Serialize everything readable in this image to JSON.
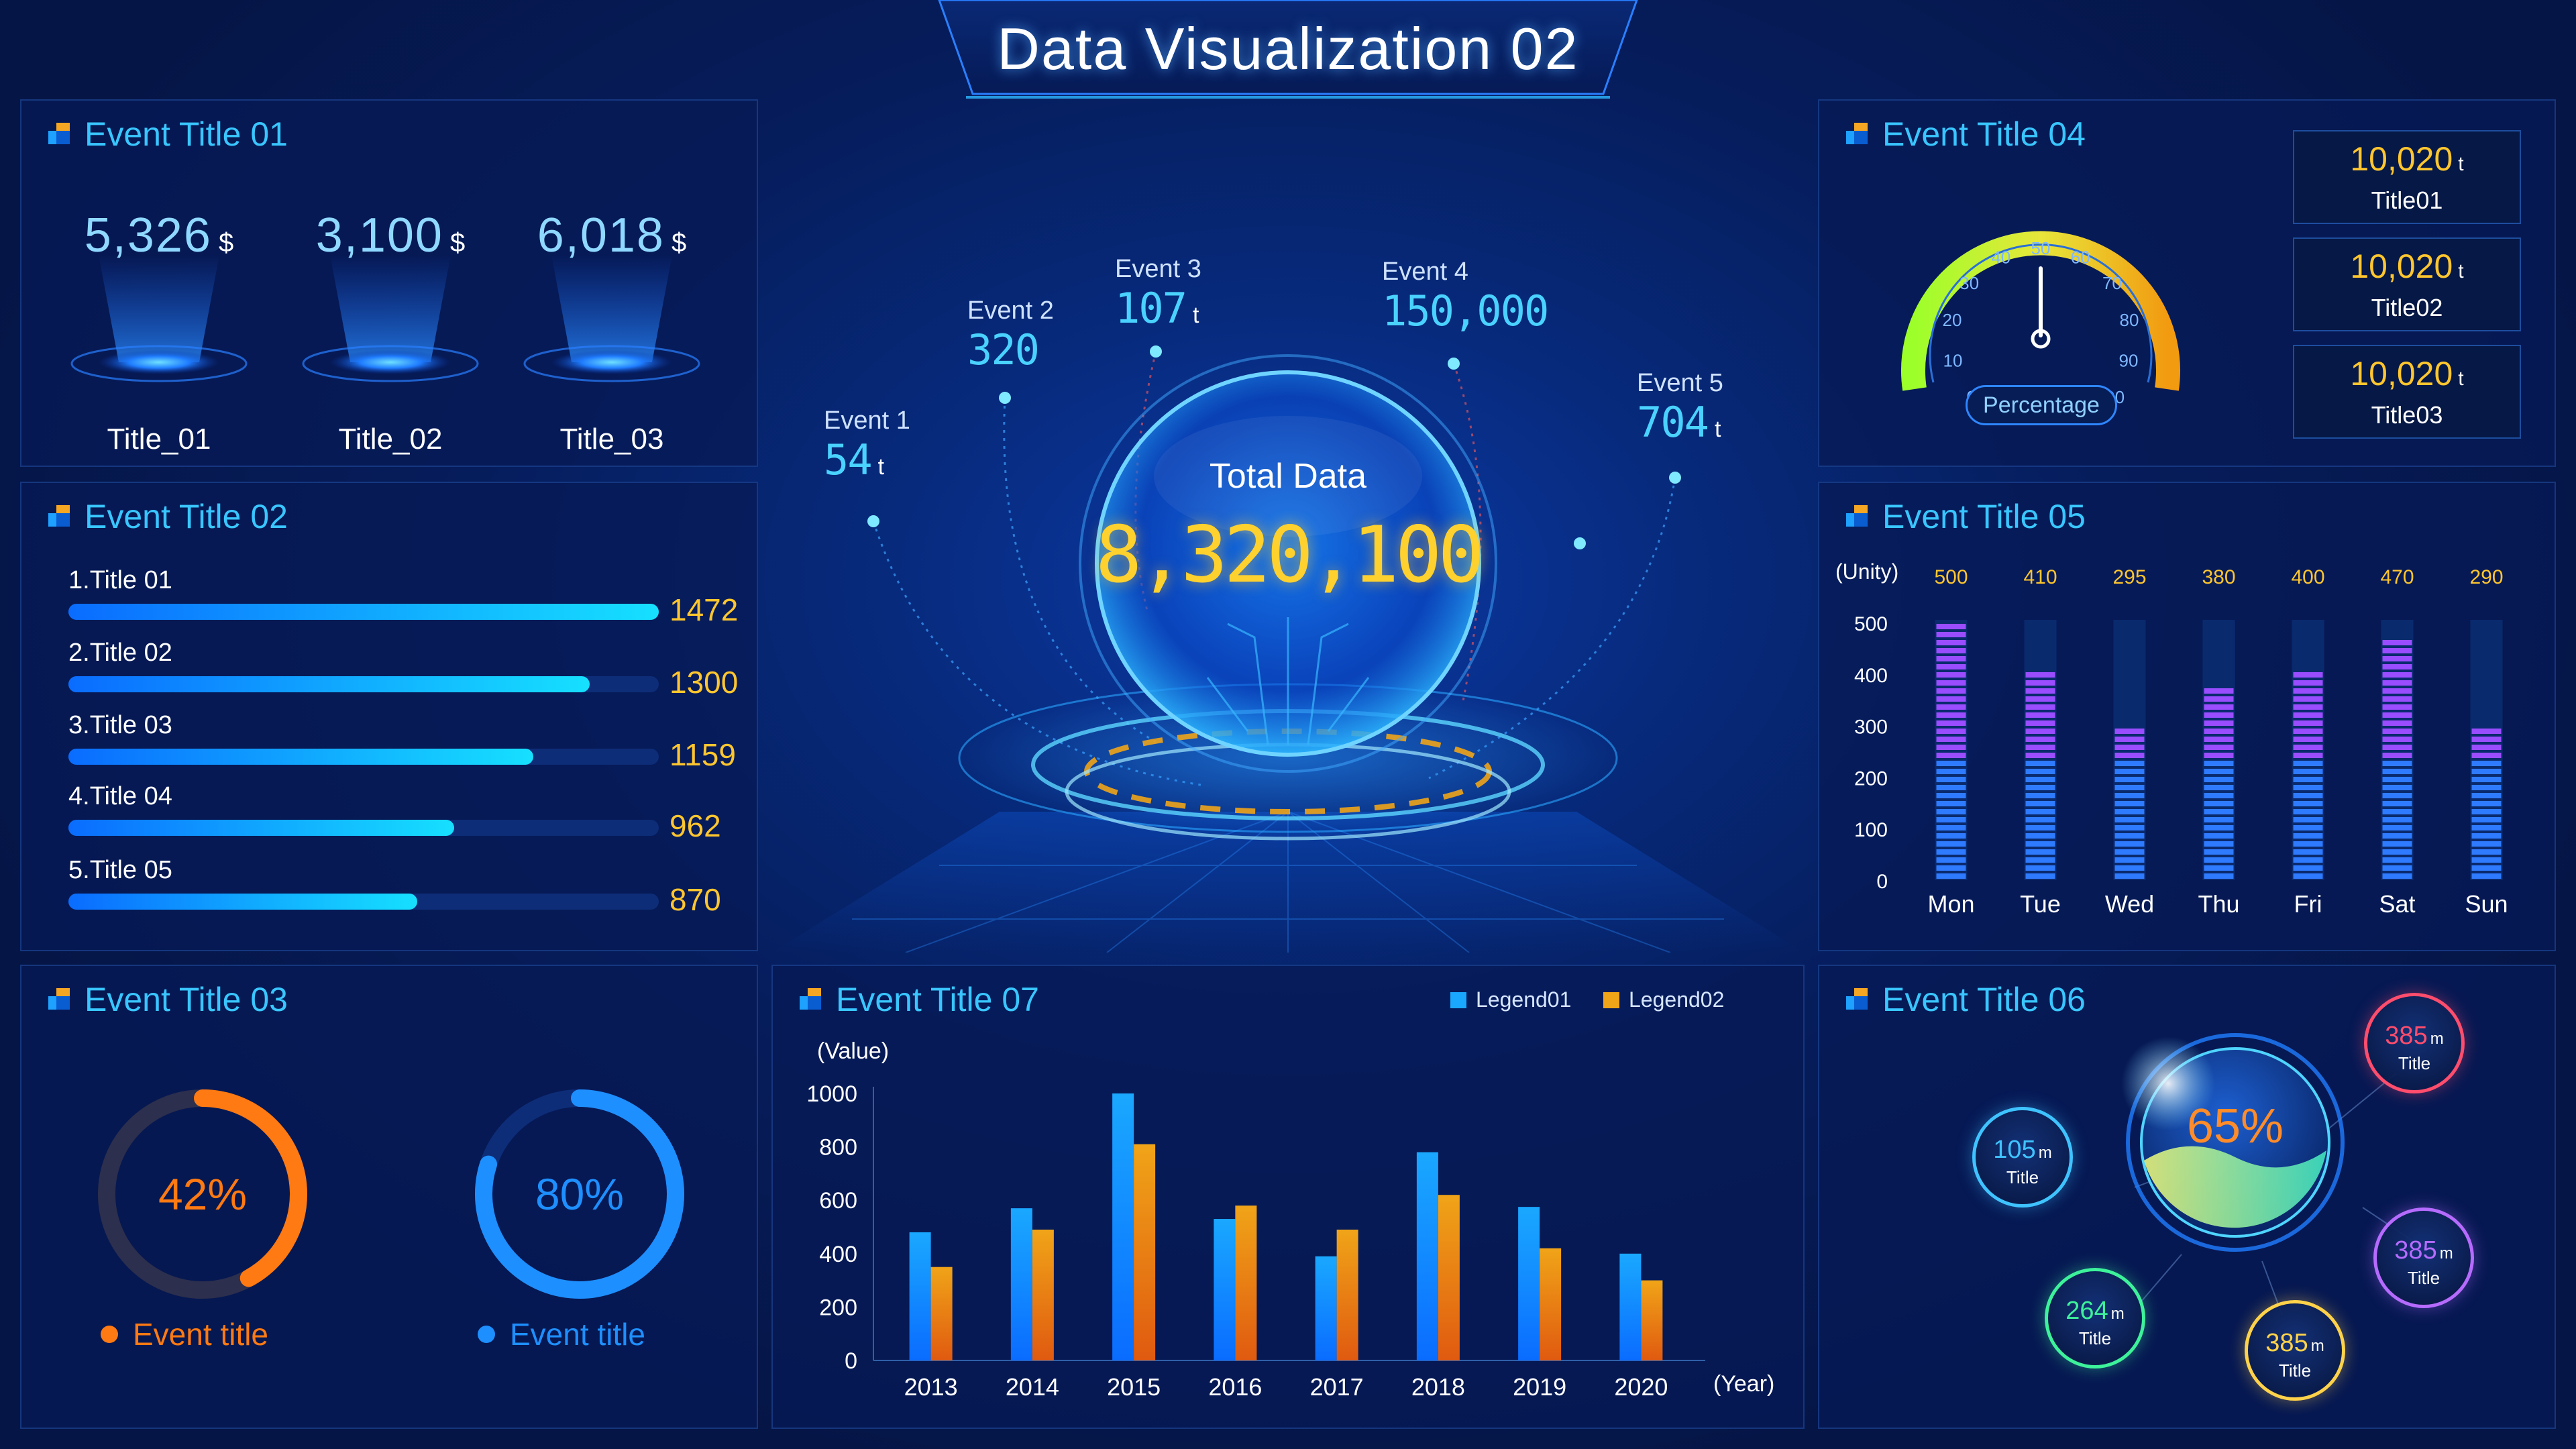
{
  "header": {
    "title": "Data Visualization 02"
  },
  "panel01": {
    "title": "Event Title 01",
    "stats": [
      {
        "value": "5,326",
        "unit": "$",
        "label": "Title_01"
      },
      {
        "value": "3,100",
        "unit": "$",
        "label": "Title_02"
      },
      {
        "value": "6,018",
        "unit": "$",
        "label": "Title_03"
      }
    ]
  },
  "panel02": {
    "title": "Event Title 02",
    "max": 1472,
    "items": [
      {
        "label": "1.Title 01",
        "value": 1472
      },
      {
        "label": "2.Title 02",
        "value": 1300
      },
      {
        "label": "3.Title 03",
        "value": 1159
      },
      {
        "label": "4.Title 04",
        "value": 962
      },
      {
        "label": "5.Title 05",
        "value": 870
      }
    ]
  },
  "panel03": {
    "title": "Event Title 03",
    "donuts": [
      {
        "percent": 42,
        "display": "42%",
        "legend": "Event title",
        "color": "#ff7a12"
      },
      {
        "percent": 80,
        "display": "80%",
        "legend": "Event title",
        "color": "#1e8fff"
      }
    ]
  },
  "center": {
    "total_label": "Total Data",
    "total_value": "8,320,100",
    "events": [
      {
        "name": "Event 1",
        "value": "54",
        "unit": "t"
      },
      {
        "name": "Event 2",
        "value": "320",
        "unit": ""
      },
      {
        "name": "Event 3",
        "value": "107",
        "unit": "t"
      },
      {
        "name": "Event 4",
        "value": "150,000",
        "unit": ""
      },
      {
        "name": "Event 5",
        "value": "704",
        "unit": "t"
      }
    ]
  },
  "panel04": {
    "title": "Event Title 04",
    "gauge": {
      "label": "Percentage",
      "value": 50,
      "ticks": [
        "0",
        "10",
        "20",
        "30",
        "40",
        "50",
        "60",
        "70",
        "80",
        "90",
        "100"
      ]
    },
    "kpis": [
      {
        "value": "10,020",
        "unit": "t",
        "label": "Title01"
      },
      {
        "value": "10,020",
        "unit": "t",
        "label": "Title02"
      },
      {
        "value": "10,020",
        "unit": "t",
        "label": "Title03"
      }
    ]
  },
  "panel05": {
    "title": "Event Title 05",
    "chart_data": {
      "type": "bar",
      "categories": [
        "Mon",
        "Tue",
        "Wed",
        "Thu",
        "Fri",
        "Sat",
        "Sun"
      ],
      "values": [
        500,
        410,
        295,
        380,
        400,
        470,
        290
      ],
      "ylabel": "(Unity)",
      "ylim": [
        0,
        500
      ],
      "yticks": [
        "0",
        "100",
        "200",
        "300",
        "400",
        "500"
      ]
    }
  },
  "panel07": {
    "title": "Event Title 07",
    "chart_data": {
      "type": "bar",
      "categories": [
        "2013",
        "2014",
        "2015",
        "2016",
        "2017",
        "2018",
        "2019",
        "2020"
      ],
      "series": [
        {
          "name": "Legend01",
          "values": [
            480,
            570,
            1000,
            530,
            390,
            780,
            575,
            400
          ],
          "color": "#1aa8ff"
        },
        {
          "name": "Legend02",
          "values": [
            350,
            490,
            810,
            580,
            490,
            620,
            420,
            300
          ],
          "color": "#f0a418"
        }
      ],
      "ylabel": "(Value)",
      "xlabel": "(Year)",
      "ylim": [
        0,
        1000
      ],
      "yticks": [
        "0",
        "200",
        "400",
        "600",
        "800",
        "1000"
      ]
    }
  },
  "panel06": {
    "title": "Event Title 06",
    "center_value": "65%",
    "bubbles": [
      {
        "value": "385",
        "unit": "m",
        "label": "Title",
        "color": "#ff4d6d"
      },
      {
        "value": "105",
        "unit": "m",
        "label": "Title",
        "color": "#3fc3ff"
      },
      {
        "value": "385",
        "unit": "m",
        "label": "Title",
        "color": "#b66bff"
      },
      {
        "value": "264",
        "unit": "m",
        "label": "Title",
        "color": "#3df29a"
      },
      {
        "value": "385",
        "unit": "m",
        "label": "Title",
        "color": "#ffd24a"
      }
    ]
  }
}
